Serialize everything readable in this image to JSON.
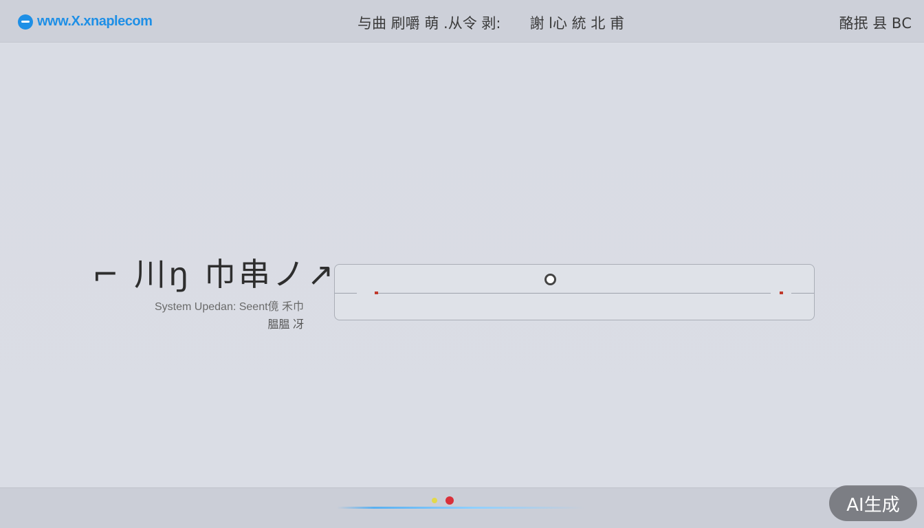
{
  "header": {
    "logo_text": "www.X.xnaplecom",
    "logo_icon": "browser-e-icon",
    "nav": [
      "与曲 刷嚼 萌 .从令 剥:",
      "謝 l心 統 北 甫"
    ],
    "right_text": "酪抿 县 ВС"
  },
  "main": {
    "headline": "⌐ 川ŋ 巾串ノ↗",
    "subtitle_line1": "System Upedan: Seent傹 禾巾",
    "subtitle_line2": "腽腽 冴"
  },
  "progress": {
    "value": 0.45
  },
  "watermark": {
    "label": "AI生成"
  },
  "colors": {
    "accent": "#1e8fe6",
    "marker": "#c0392b"
  }
}
